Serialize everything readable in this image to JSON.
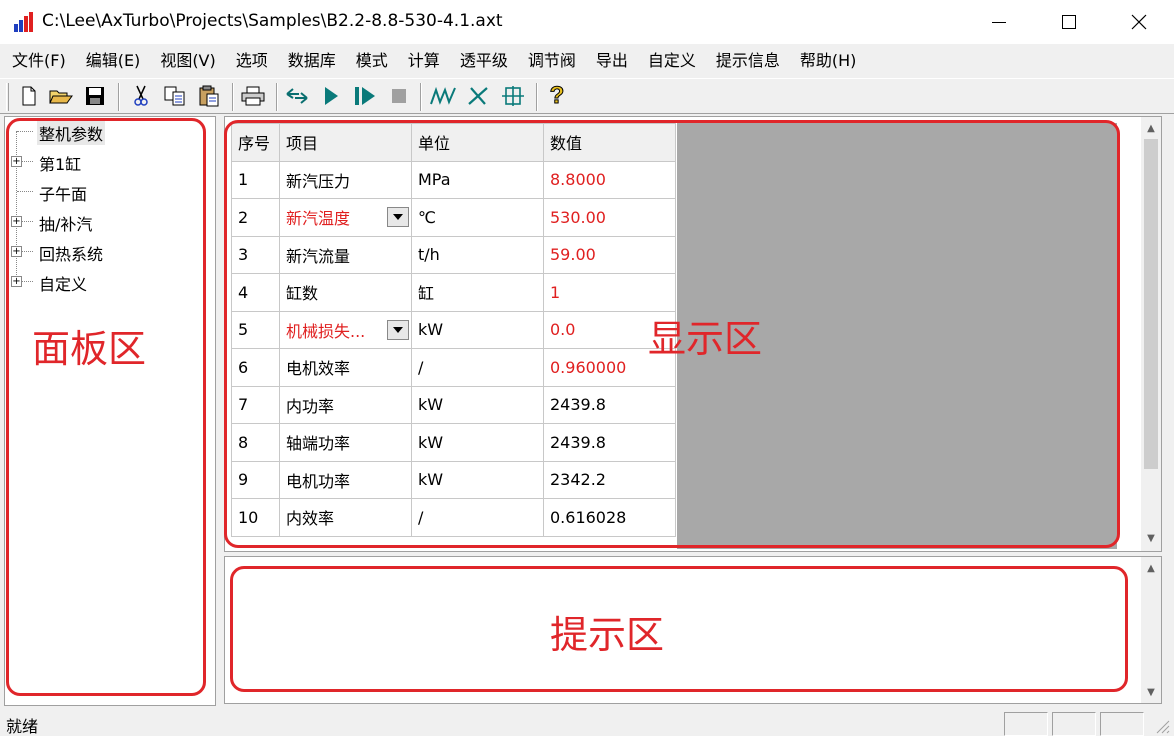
{
  "window": {
    "title": "C:\\Lee\\AxTurbo\\Projects\\Samples\\B2.2-8.8-530-4.1.axt",
    "icon": "bar-chart-app-icon"
  },
  "menu": [
    "文件(F)",
    "编辑(E)",
    "视图(V)",
    "选项",
    "数据库",
    "模式",
    "计算",
    "透平级",
    "调节阀",
    "导出",
    "自定义",
    "提示信息",
    "帮助(H)"
  ],
  "toolbar": {
    "buttons": [
      "new-file-icon",
      "open-folder-icon",
      "save-icon",
      "cut-icon",
      "copy-icon",
      "paste-icon",
      "print-icon",
      "swap-icon",
      "run-icon",
      "step-run-icon",
      "stop-icon",
      "curve-icon",
      "x-curve-icon",
      "diagram-icon",
      "help-icon"
    ],
    "help_glyph": "?"
  },
  "tree": {
    "items": [
      {
        "label": "整机参数",
        "expandable": false,
        "selected": true
      },
      {
        "label": "第1缸",
        "expandable": true
      },
      {
        "label": "子午面",
        "expandable": false
      },
      {
        "label": "抽/补汽",
        "expandable": true
      },
      {
        "label": "回热系统",
        "expandable": true
      },
      {
        "label": "自定义",
        "expandable": true
      }
    ],
    "expand_glyph": "+"
  },
  "grid": {
    "headers": [
      "序号",
      "项目",
      "单位",
      "数值"
    ],
    "rows": [
      {
        "idx": "1",
        "item": "新汽压力",
        "unit": "MPa",
        "value": "8.8000",
        "item_red": false,
        "value_red": true,
        "dropdown": false
      },
      {
        "idx": "2",
        "item": "新汽温度",
        "unit": "℃",
        "value": "530.00",
        "item_red": true,
        "value_red": true,
        "dropdown": true
      },
      {
        "idx": "3",
        "item": "新汽流量",
        "unit": "t/h",
        "value": "59.00",
        "item_red": false,
        "value_red": true,
        "dropdown": false
      },
      {
        "idx": "4",
        "item": "缸数",
        "unit": "缸",
        "value": "1",
        "item_red": false,
        "value_red": true,
        "dropdown": false
      },
      {
        "idx": "5",
        "item": "机械损失...",
        "unit": "kW",
        "value": "0.0",
        "item_red": true,
        "value_red": true,
        "dropdown": true
      },
      {
        "idx": "6",
        "item": "电机效率",
        "unit": "/",
        "value": "0.960000",
        "item_red": false,
        "value_red": true,
        "dropdown": false
      },
      {
        "idx": "7",
        "item": "内功率",
        "unit": "kW",
        "value": "2439.8",
        "item_red": false,
        "value_red": false,
        "dropdown": false
      },
      {
        "idx": "8",
        "item": "轴端功率",
        "unit": "kW",
        "value": "2439.8",
        "item_red": false,
        "value_red": false,
        "dropdown": false
      },
      {
        "idx": "9",
        "item": "电机功率",
        "unit": "kW",
        "value": "2342.2",
        "item_red": false,
        "value_red": false,
        "dropdown": false
      },
      {
        "idx": "10",
        "item": "内效率",
        "unit": "/",
        "value": "0.616028",
        "item_red": false,
        "value_red": false,
        "dropdown": false
      }
    ]
  },
  "annotations": {
    "panel": "面板区",
    "display": "显示区",
    "hint": "提示区"
  },
  "status": {
    "text": "就绪"
  },
  "colors": {
    "annotation_red": "#e0262a",
    "value_red": "#e02020",
    "grid_gray": "#a8a8a8"
  }
}
